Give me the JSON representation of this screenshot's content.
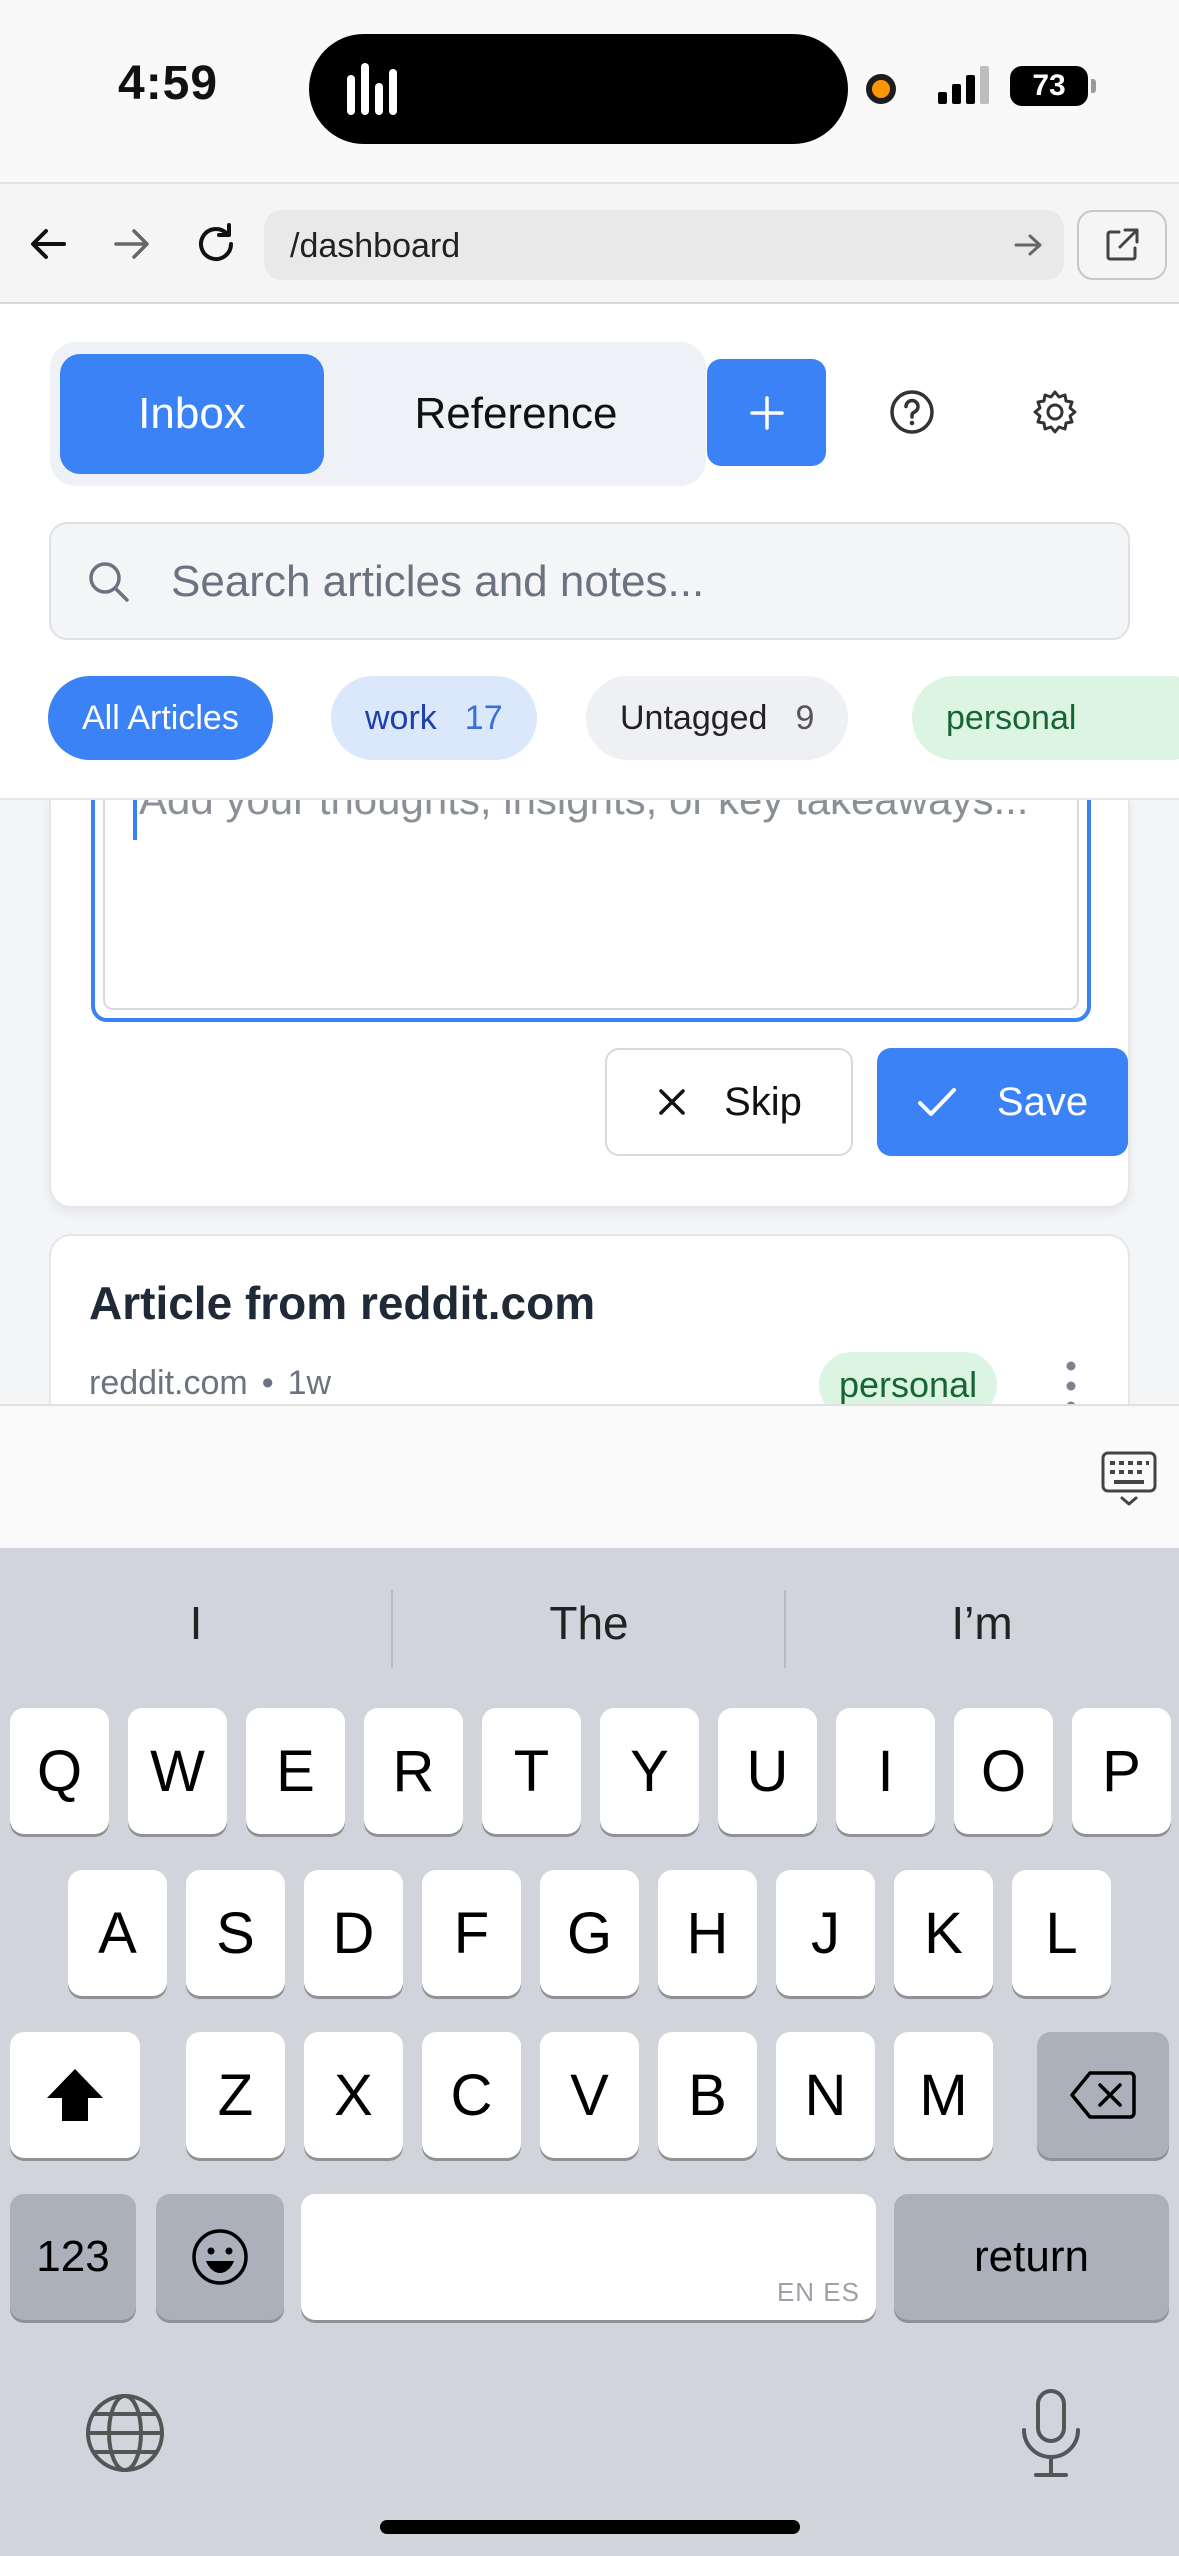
{
  "status_bar": {
    "time": "4:59",
    "battery": "73"
  },
  "browser": {
    "url": "/dashboard"
  },
  "header": {
    "tabs": [
      {
        "label": "Inbox",
        "active": true
      },
      {
        "label": "Reference",
        "active": false
      }
    ],
    "add_label": "+"
  },
  "search": {
    "placeholder": "Search articles and notes...",
    "value": ""
  },
  "filters": [
    {
      "label": "All Articles",
      "count": ""
    },
    {
      "label": "work",
      "count": "17"
    },
    {
      "label": "Untagged",
      "count": "9"
    },
    {
      "label": "personal",
      "count": ""
    }
  ],
  "note_editor": {
    "placeholder": "Add your thoughts, insights, or key takeaways...",
    "skip_label": "Skip",
    "save_label": "Save"
  },
  "article": {
    "title": "Article from reddit.com",
    "source": "reddit.com",
    "age": "1w",
    "tag": "personal"
  },
  "keyboard": {
    "suggestions": [
      "I",
      "The",
      "I’m"
    ],
    "row1": [
      "Q",
      "W",
      "E",
      "R",
      "T",
      "Y",
      "U",
      "I",
      "O",
      "P"
    ],
    "row2": [
      "A",
      "S",
      "D",
      "F",
      "G",
      "H",
      "J",
      "K",
      "L"
    ],
    "row3": [
      "Z",
      "X",
      "C",
      "V",
      "B",
      "N",
      "M"
    ],
    "numbers_label": "123",
    "space_hint": "EN ES",
    "return_label": "return"
  },
  "colors": {
    "accent": "#3b82f6",
    "work_chip_bg": "#dbe7fb",
    "personal_chip_bg": "#dcf5e2",
    "keyboard_bg": "#d1d4da"
  }
}
